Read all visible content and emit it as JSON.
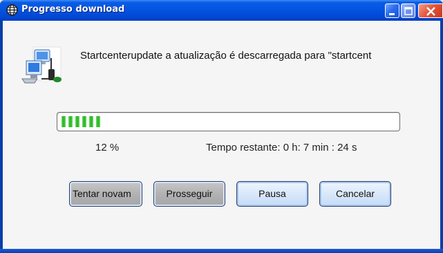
{
  "window": {
    "title": "Progresso download",
    "title_icon": "globe-icon",
    "controls": [
      "minimize-icon",
      "maximize-icon",
      "close-icon"
    ]
  },
  "message": "Startcenterupdate a atualização é descarregada para \"startcent",
  "app_icon": "network-computer-icon",
  "progress": {
    "percent_value": 12,
    "percent_label": "12 %",
    "time_remaining": "Tempo restante: 0 h: 7 min : 24 s",
    "color": "#21b11a"
  },
  "buttons": {
    "retry": "Tentar novam",
    "continue": "Prosseguir",
    "pause": "Pausa",
    "cancel": "Cancelar"
  }
}
